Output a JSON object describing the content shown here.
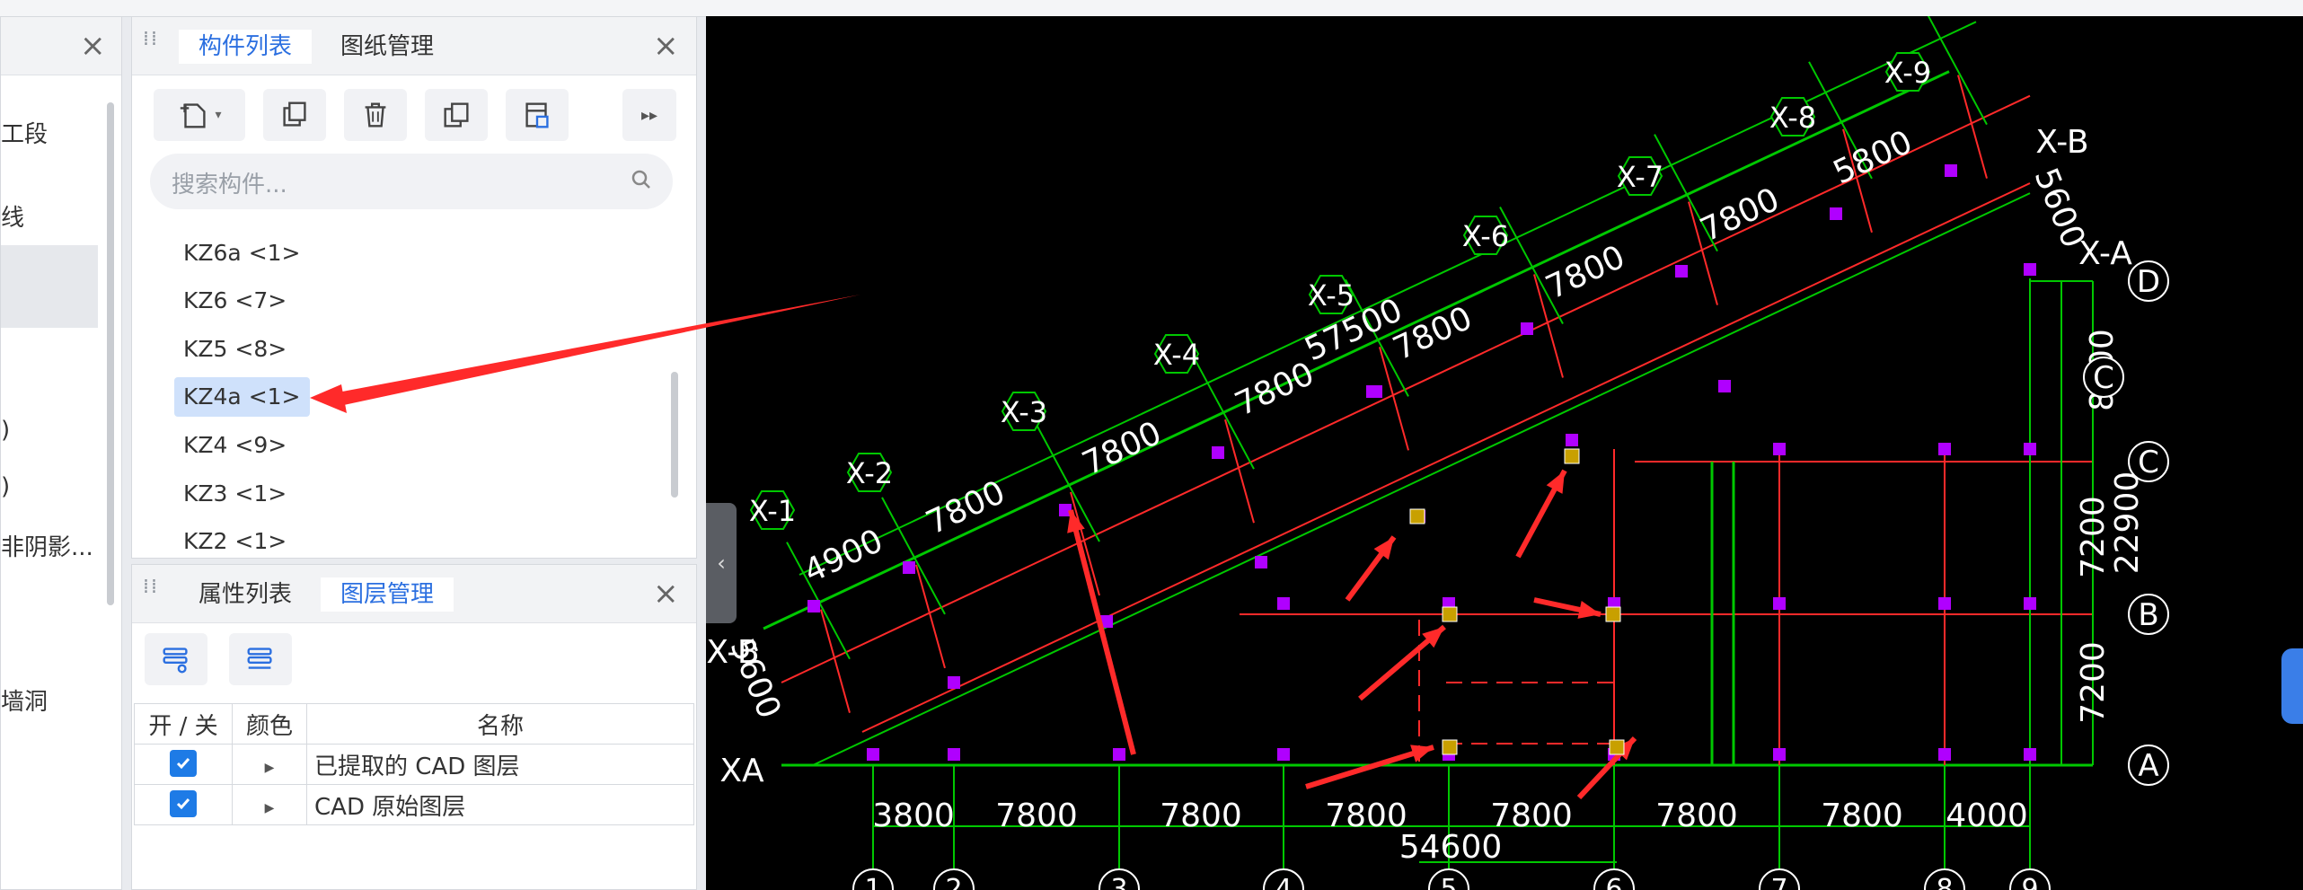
{
  "left_panel": {
    "items": [
      "工段",
      "线",
      ")",
      ")",
      "非阴影...",
      "墙洞"
    ]
  },
  "component_panel": {
    "tabs": [
      "构件列表",
      "图纸管理"
    ],
    "search_placeholder": "搜索构件...",
    "components": [
      "KZ6a <1>",
      "KZ6 <7>",
      "KZ5 <8>",
      "KZ4a <1>",
      "KZ4 <9>",
      "KZ3 <1>",
      "KZ2 <1>"
    ],
    "selected_component": "KZ4a <1>"
  },
  "layer_panel": {
    "tabs": [
      "属性列表",
      "图层管理"
    ],
    "columns": [
      "开 / 关",
      "颜色",
      "名称"
    ],
    "rows": [
      {
        "checked": true,
        "name": "已提取的 CAD 图层"
      },
      {
        "checked": true,
        "name": "CAD 原始图层"
      }
    ]
  },
  "cad": {
    "slanted_axes": [
      "X-1",
      "X-2",
      "X-3",
      "X-4",
      "X-5",
      "X-6",
      "X-7",
      "X-8",
      "X-9"
    ],
    "slanted_dims": [
      "4900",
      "7800",
      "7800",
      "7800",
      "57500",
      "7800",
      "7800",
      "7800",
      "5800"
    ],
    "right_dims": [
      "5600",
      "8500",
      "7200",
      "22900",
      "7200"
    ],
    "left_dims": [
      "5600"
    ],
    "side_labels": [
      "X-B",
      "X-A",
      "X-B",
      "XA"
    ],
    "row_axes": [
      "D",
      "C",
      "C",
      "B",
      "A"
    ],
    "bottom_dims": [
      "3800",
      "7800",
      "7800",
      "7800",
      "7800",
      "7800",
      "7800",
      "4000"
    ],
    "total_dim": "54600",
    "col_axes": [
      "1",
      "2",
      "3",
      "4",
      "5",
      "6",
      "7",
      "8",
      "9"
    ]
  },
  "colors": {
    "accent": "#2b6fe0",
    "cad_bg": "#000000",
    "green": "#00c800",
    "red": "#ff2a2a",
    "magenta": "#b000ff"
  }
}
